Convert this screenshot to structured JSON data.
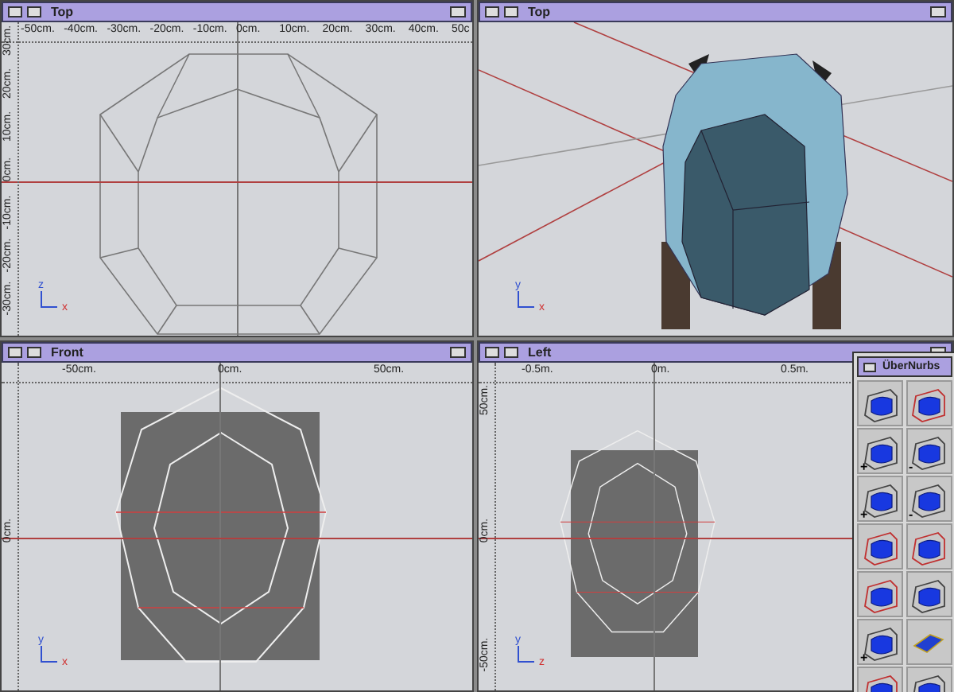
{
  "viewports": [
    {
      "title": "Top",
      "kind": "top",
      "x_ruler": [
        "-50cm.",
        "-40cm.",
        "-30cm.",
        "-20cm.",
        "-10cm.",
        "0cm.",
        "10cm.",
        "20cm.",
        "30cm.",
        "40cm.",
        "50c"
      ],
      "y_ruler": [
        "30cm.",
        "20cm.",
        "10cm.",
        "0cm.",
        "-10cm.",
        "-20cm.",
        "-30cm."
      ],
      "axis_labels": [
        "z",
        "x"
      ]
    },
    {
      "title": "Top",
      "kind": "perspective",
      "axis_labels": [
        "y",
        "x"
      ]
    },
    {
      "title": "Front",
      "kind": "front",
      "x_ruler": [
        "-50cm.",
        "0cm.",
        "50cm."
      ],
      "y_ruler": [
        "0cm."
      ],
      "axis_labels": [
        "y",
        "x"
      ]
    },
    {
      "title": "Left",
      "kind": "left",
      "x_ruler": [
        "-0.5m.",
        "0m.",
        "0.5m."
      ],
      "y_ruler": [
        "50cm.",
        "0cm.",
        "-50cm."
      ],
      "axis_labels": [
        "y",
        "z"
      ]
    }
  ],
  "palette": {
    "title": "ÜberNurbs",
    "tools": [
      {
        "kind": "gray-cage"
      },
      {
        "kind": "red-cage"
      },
      {
        "kind": "gray-cage",
        "sign": "+"
      },
      {
        "kind": "gray-cage",
        "sign": "-"
      },
      {
        "kind": "gray-cage",
        "sign": "+"
      },
      {
        "kind": "gray-cage",
        "sign": "-"
      },
      {
        "kind": "red-cage"
      },
      {
        "kind": "red-cage"
      },
      {
        "kind": "red-cage"
      },
      {
        "kind": "gray-cage"
      },
      {
        "kind": "gray-cage",
        "sign": "+"
      },
      {
        "kind": "flat"
      },
      {
        "kind": "red-cage"
      },
      {
        "kind": "gray-cage"
      }
    ]
  }
}
